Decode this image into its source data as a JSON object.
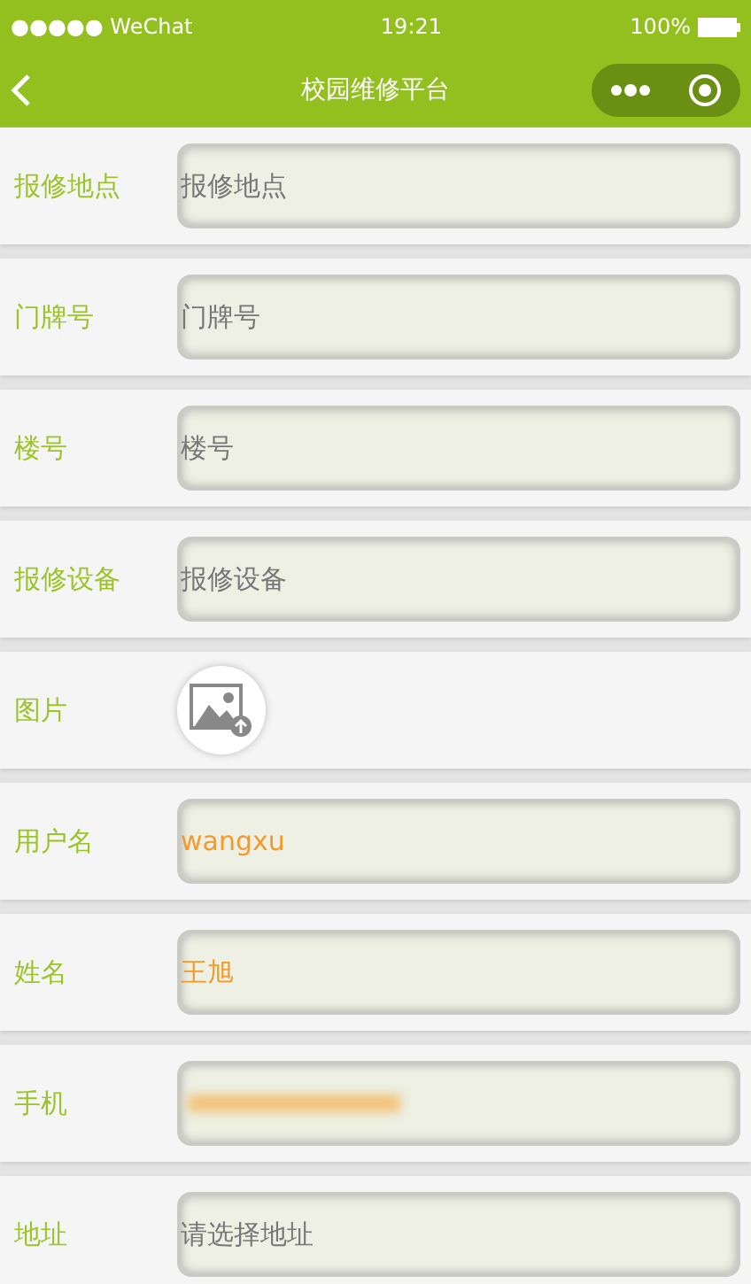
{
  "status_bar": {
    "carrier": "●●●●● WeChat",
    "time": "19:21",
    "battery": "100%"
  },
  "nav": {
    "title": "校园维修平台"
  },
  "form": [
    {
      "kind": "input",
      "label": "报修地点",
      "placeholder": "报修地点"
    },
    {
      "kind": "input",
      "label": "门牌号",
      "placeholder": "门牌号"
    },
    {
      "kind": "input",
      "label": "楼号",
      "placeholder": "楼号"
    },
    {
      "kind": "input",
      "label": "报修设备",
      "placeholder": "报修设备"
    },
    {
      "kind": "image",
      "label": "图片"
    },
    {
      "kind": "input",
      "label": "用户名",
      "value": "wangxu"
    },
    {
      "kind": "input",
      "label": "姓名",
      "value": "王旭"
    },
    {
      "kind": "redacted",
      "label": "手机"
    },
    {
      "kind": "input",
      "label": "地址",
      "placeholder": "请选择地址"
    }
  ]
}
